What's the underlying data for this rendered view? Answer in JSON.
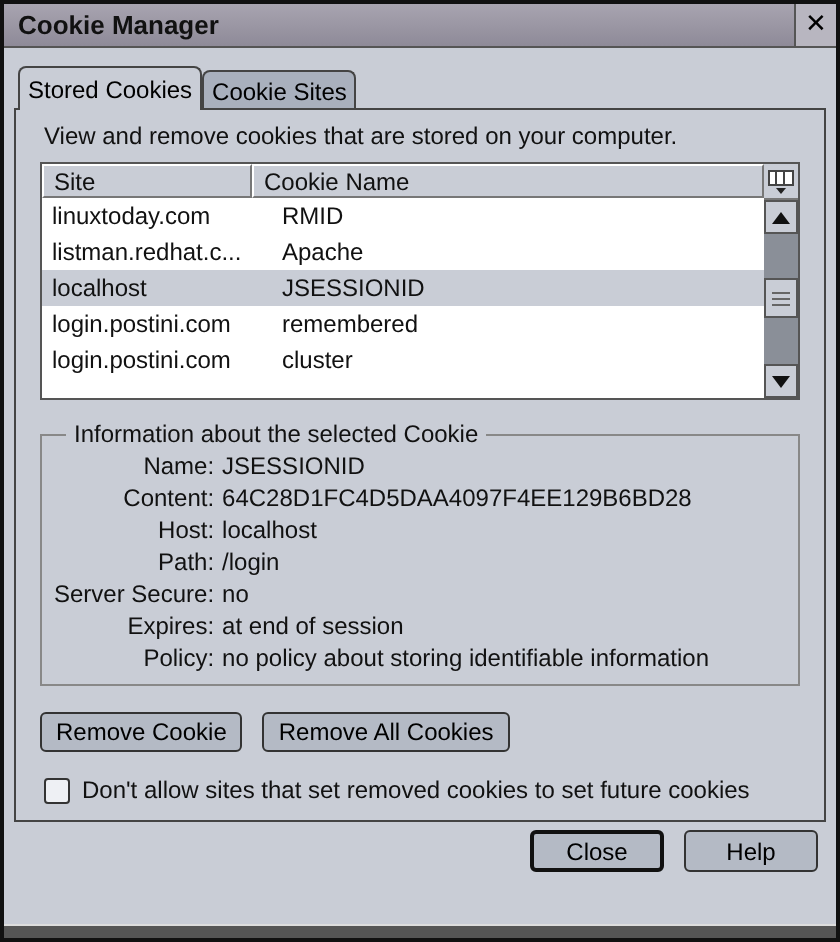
{
  "window": {
    "title": "Cookie Manager",
    "close": "✕"
  },
  "tabs": [
    {
      "label": "Stored Cookies",
      "selected": true
    },
    {
      "label": "Cookie Sites",
      "selected": false
    }
  ],
  "description": "View and remove cookies that are stored on your computer.",
  "table": {
    "columns": [
      "Site",
      "Cookie Name"
    ],
    "rows": [
      {
        "site": "linuxtoday.com",
        "name": "RMID",
        "selected": false
      },
      {
        "site": "listman.redhat.c...",
        "name": "Apache",
        "selected": false
      },
      {
        "site": "localhost",
        "name": "JSESSIONID",
        "selected": true
      },
      {
        "site": "login.postini.com",
        "name": "remembered",
        "selected": false
      },
      {
        "site": "login.postini.com",
        "name": "cluster",
        "selected": false
      }
    ]
  },
  "info": {
    "title": "Information about the selected Cookie",
    "fields": [
      {
        "label": "Name:",
        "value": "JSESSIONID"
      },
      {
        "label": "Content:",
        "value": "64C28D1FC4D5DAA4097F4EE129B6BD28"
      },
      {
        "label": "Host:",
        "value": "localhost"
      },
      {
        "label": "Path:",
        "value": "/login"
      },
      {
        "label": "Server Secure:",
        "value": "no"
      },
      {
        "label": "Expires:",
        "value": "at end of session"
      },
      {
        "label": "Policy:",
        "value": "no policy about storing identifiable information"
      }
    ]
  },
  "buttons": [
    "Remove Cookie",
    "Remove All Cookies"
  ],
  "block_option": {
    "label": "Don't allow sites that set removed cookies to set future cookies",
    "checked": false
  },
  "footer_buttons": [
    {
      "label": "Close",
      "default": true
    },
    {
      "label": "Help",
      "default": false
    }
  ]
}
